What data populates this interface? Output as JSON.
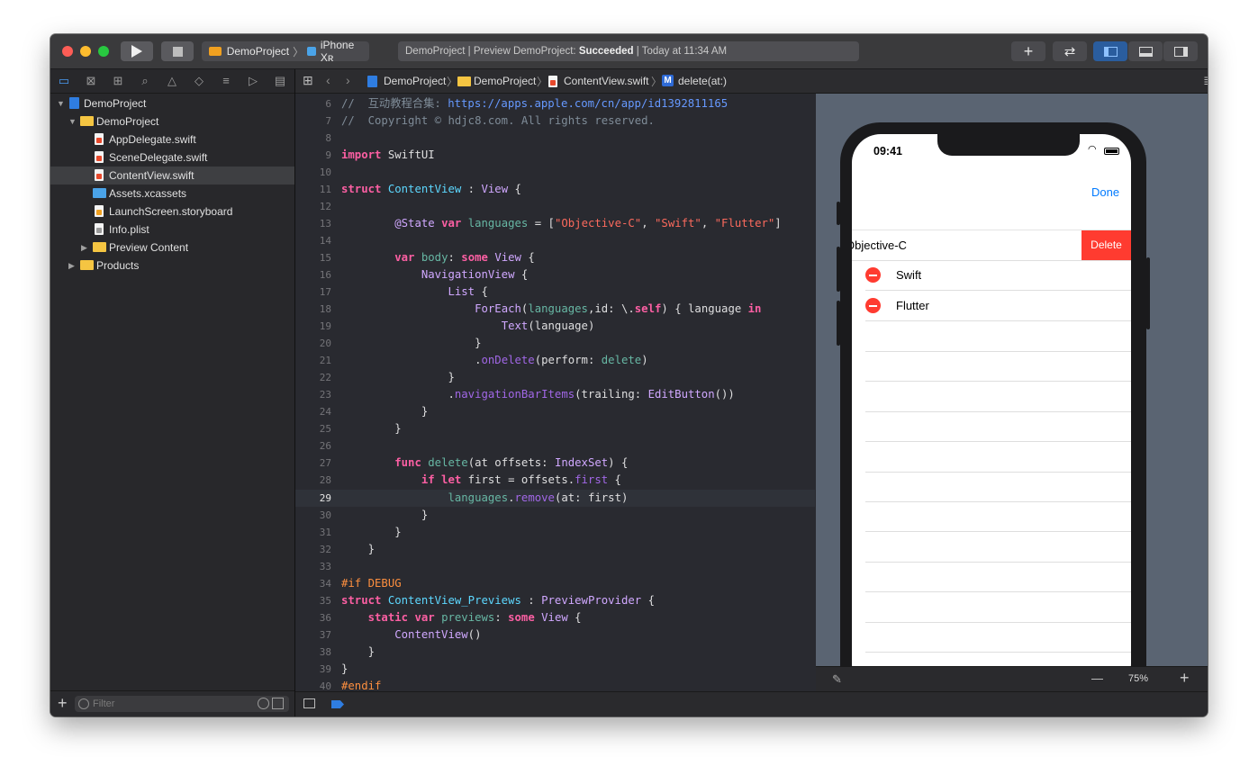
{
  "toolbar": {
    "scheme": "DemoProject",
    "device": "iPhone Xʀ",
    "status_prefix": "DemoProject | Preview DemoProject:",
    "status_result": "Succeeded",
    "status_time": "| Today at 11:34 AM"
  },
  "navigator": {
    "items": [
      {
        "label": "DemoProject"
      },
      {
        "label": "DemoProject"
      },
      {
        "label": "AppDelegate.swift"
      },
      {
        "label": "SceneDelegate.swift"
      },
      {
        "label": "ContentView.swift"
      },
      {
        "label": "Assets.xcassets"
      },
      {
        "label": "LaunchScreen.storyboard"
      },
      {
        "label": "Info.plist"
      },
      {
        "label": "Preview Content"
      },
      {
        "label": "Products"
      }
    ],
    "filter_placeholder": "Filter"
  },
  "jumpbar": {
    "crumbs": [
      "DemoProject",
      "DemoProject",
      "ContentView.swift",
      "delete(at:)"
    ],
    "method_badge": "M"
  },
  "editor": {
    "line_numbers": [
      "6",
      "7",
      "8",
      "9",
      "10",
      "11",
      "12",
      "13",
      "14",
      "15",
      "16",
      "17",
      "18",
      "19",
      "20",
      "21",
      "22",
      "23",
      "24",
      "25",
      "26",
      "27",
      "28",
      "29",
      "30",
      "31",
      "32",
      "33",
      "34",
      "35",
      "36",
      "37",
      "38",
      "39",
      "40"
    ],
    "current_line": "29"
  },
  "preview": {
    "time": "09:41",
    "done_label": "Done",
    "delete_label": "Delete",
    "rows": [
      "Objective-C",
      "Swift",
      "Flutter"
    ],
    "zoom": "75%",
    "zoom_minus": "—",
    "zoom_plus": "+"
  },
  "colors": {
    "accent": "#007aff",
    "delete": "#ff3b30",
    "keyword": "#fc5fa3",
    "string": "#fc6a5d"
  }
}
